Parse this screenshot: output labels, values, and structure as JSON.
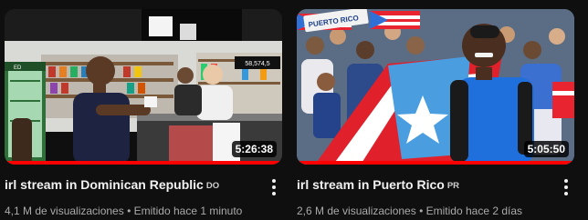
{
  "videos": [
    {
      "title": "irl stream in Dominican Republic",
      "country_badge": "DO",
      "duration": "5:26:38",
      "views": "4,1 M de visualizaciones",
      "separator": "•",
      "posted": "Emitido hace 1 minuto",
      "watched_fraction": 1.0,
      "thumb_text": {
        "shelf_sign": "58,574,5",
        "sticker": "ED"
      }
    },
    {
      "title": "irl stream in Puerto Rico",
      "country_badge": "PR",
      "duration": "5:05:50",
      "views": "2,6 M de visualizaciones",
      "separator": "•",
      "posted": "Emitido hace 2 días",
      "watched_fraction": 1.0,
      "thumb_text": {
        "sign": "PUERTO RICO"
      }
    }
  ],
  "colors": {
    "background": "#0f0f0f",
    "progress": "#ff0000",
    "meta_text": "#aaaaaa",
    "flag_blue": "#4a9ee0",
    "flag_red": "#e0202a"
  }
}
